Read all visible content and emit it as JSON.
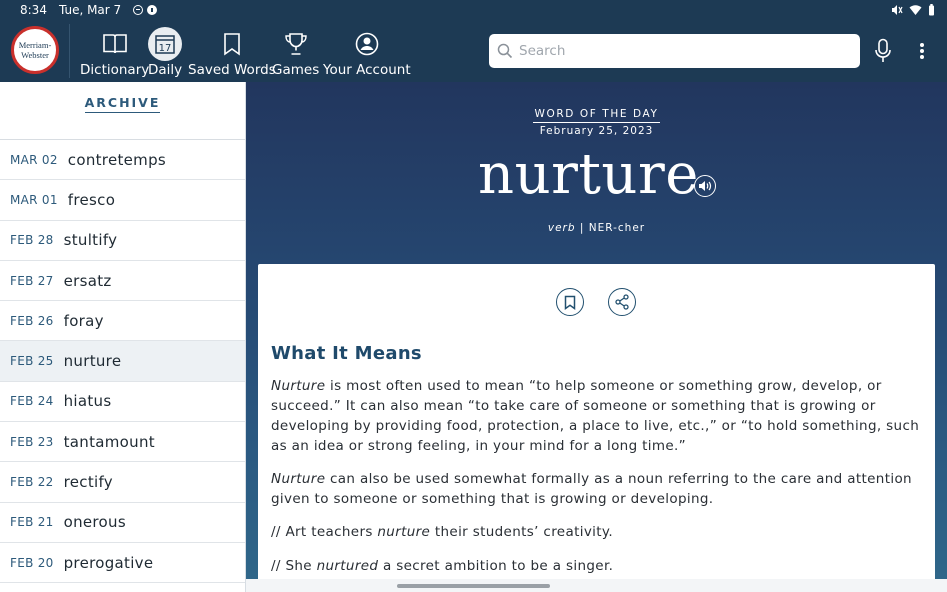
{
  "status_bar": {
    "time": "8:34",
    "date": "Tue, Mar 7"
  },
  "logo": {
    "line1": "Merriam-",
    "line2": "Webster"
  },
  "nav": {
    "dictionary": "Dictionary",
    "daily": "Daily",
    "daily_day": "17",
    "saved_words": "Saved Words",
    "games": "Games",
    "account": "Your Account"
  },
  "search": {
    "placeholder": "Search",
    "value": ""
  },
  "sidebar": {
    "heading": "ARCHIVE",
    "items": [
      {
        "date": "MAR 02",
        "word": "contretemps"
      },
      {
        "date": "MAR 01",
        "word": "fresco"
      },
      {
        "date": "FEB 28",
        "word": "stultify"
      },
      {
        "date": "FEB 27",
        "word": "ersatz"
      },
      {
        "date": "FEB 26",
        "word": "foray"
      },
      {
        "date": "FEB 25",
        "word": "nurture",
        "selected": true
      },
      {
        "date": "FEB 24",
        "word": "hiatus"
      },
      {
        "date": "FEB 23",
        "word": "tantamount"
      },
      {
        "date": "FEB 22",
        "word": "rectify"
      },
      {
        "date": "FEB 21",
        "word": "onerous"
      },
      {
        "date": "FEB 20",
        "word": "prerogative"
      }
    ]
  },
  "wotd": {
    "label": "WORD OF THE DAY",
    "date": "February 25, 2023",
    "word": "nurture",
    "pos": "verb",
    "separator": "|",
    "pronunciation": "NER-cher"
  },
  "definition": {
    "heading": "What It Means",
    "p1_word": "Nurture",
    "p1_text": " is most often used to mean “to help someone or something grow, develop, or succeed.” It can also mean “to take care of someone or something that is growing or developing by providing food, protection, a place to live, etc.,” or “to hold something, such as an idea or strong feeling, in your mind for a long time.”",
    "p2_word": "Nurture",
    "p2_text": " can also be used somewhat formally as a noun referring to the care and attention given to someone or something that is growing or developing.",
    "ex1_pre": "// Art teachers ",
    "ex1_word": "nurture",
    "ex1_post": " their students’ creativity.",
    "ex2_pre": "// She ",
    "ex2_word": "nurtured",
    "ex2_post": " a secret ambition to be a singer."
  },
  "colors": {
    "header": "#1d3a54",
    "accent": "#2d5a7b",
    "logo_ring": "#c9302c"
  }
}
